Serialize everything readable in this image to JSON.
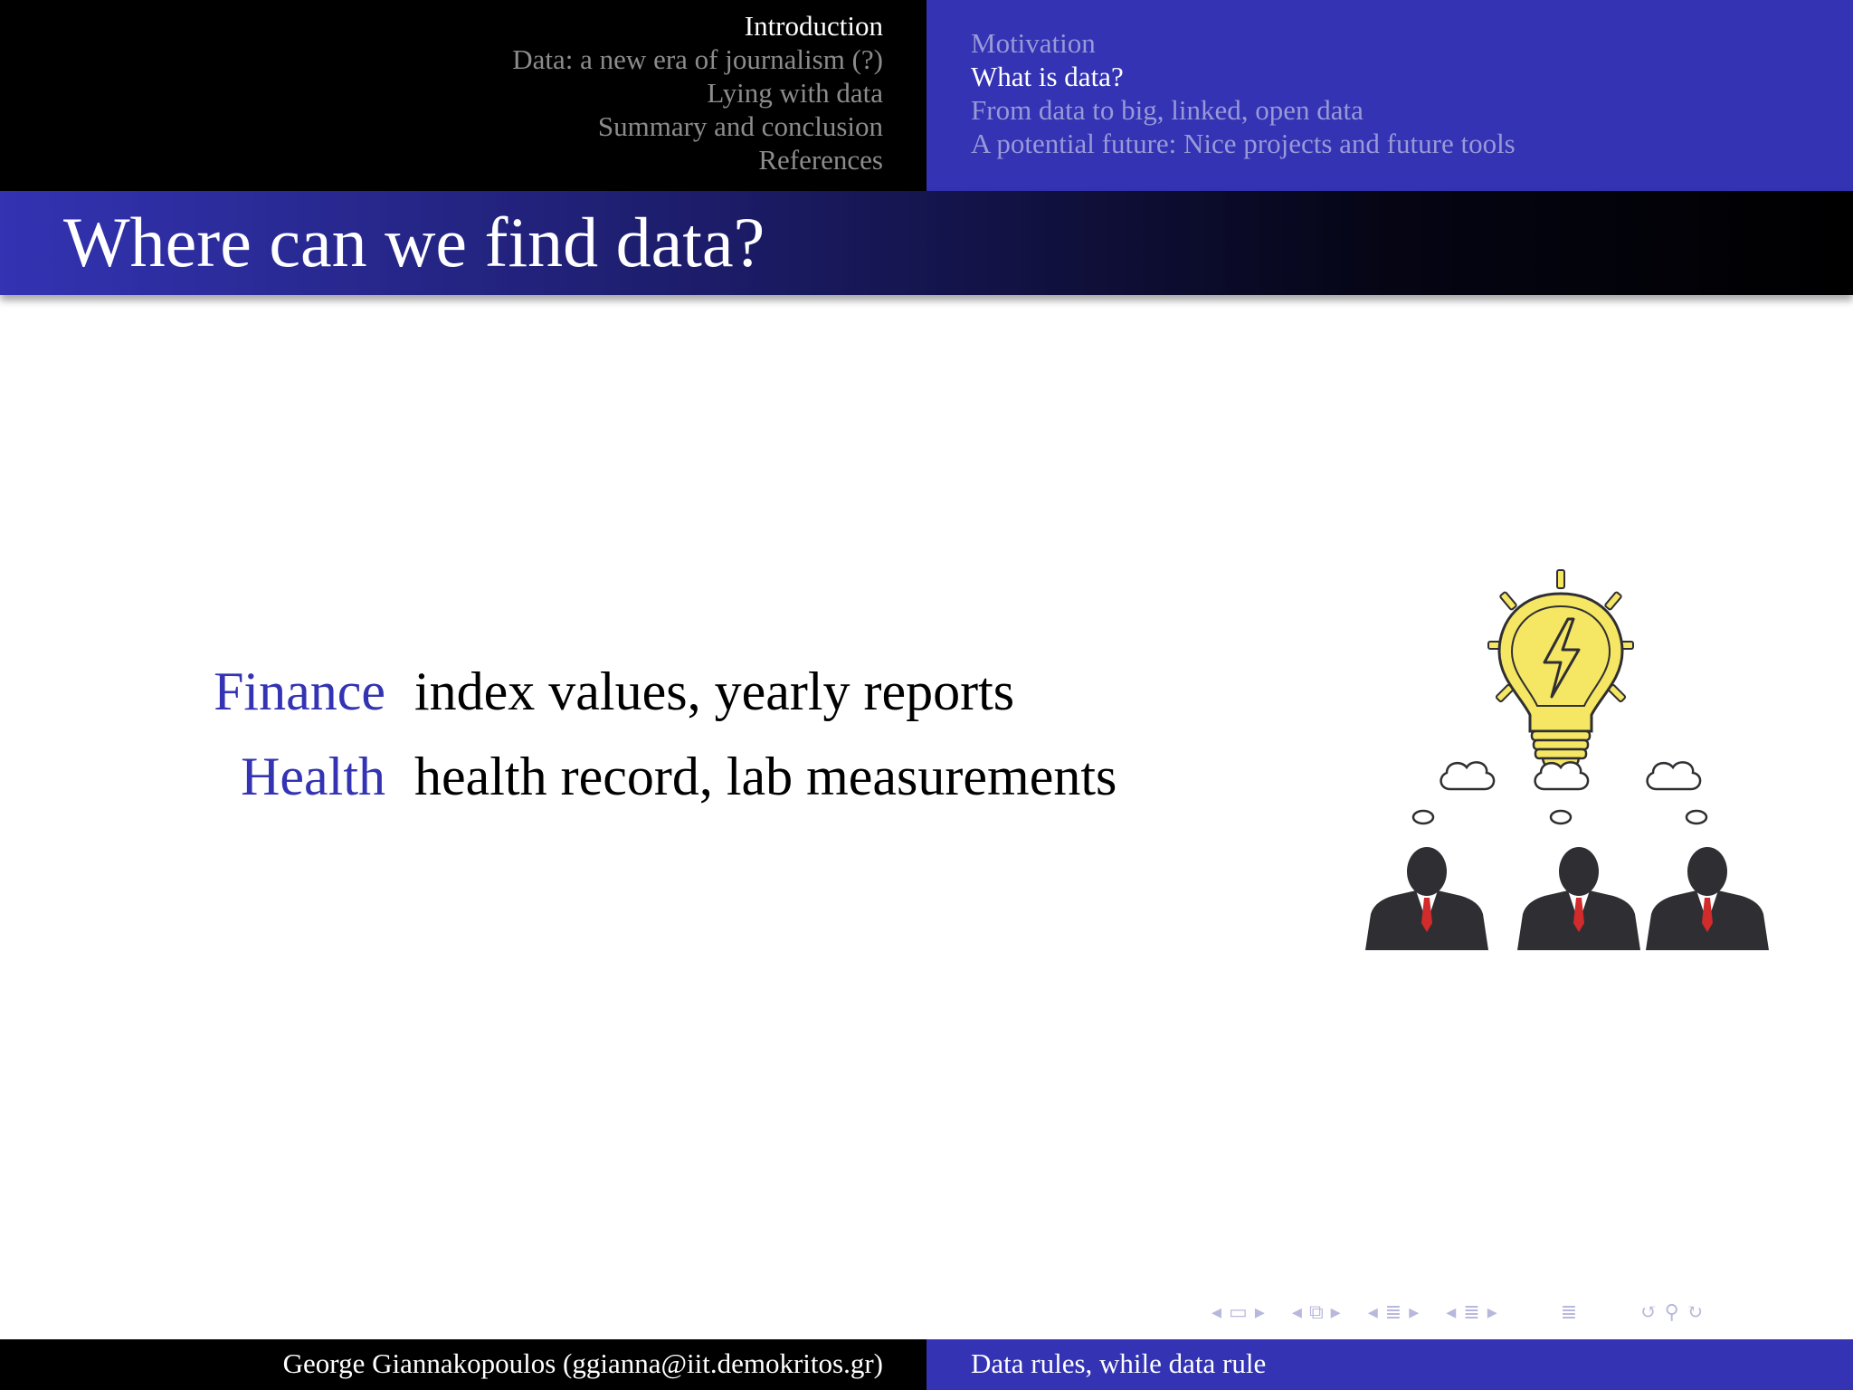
{
  "header": {
    "sections": [
      {
        "label": "Introduction",
        "active": true
      },
      {
        "label": "Data: a new era of  journalism (?)",
        "active": false
      },
      {
        "label": "Lying with data",
        "active": false
      },
      {
        "label": "Summary and conclusion",
        "active": false
      },
      {
        "label": "References",
        "active": false
      }
    ],
    "subsections": [
      {
        "label": "Motivation",
        "active": false
      },
      {
        "label": "What is data?",
        "active": true
      },
      {
        "label": "From data to big, linked, open data",
        "active": false
      },
      {
        "label": "A potential future: Nice projects and future tools",
        "active": false
      }
    ]
  },
  "frame": {
    "title": "Where can we find data?",
    "items": [
      {
        "term": "Finance",
        "definition": "index values, yearly reports"
      },
      {
        "term": "Health",
        "definition": "health record, lab measurements"
      }
    ]
  },
  "illustration": {
    "icons": [
      "lightbulb-icon",
      "thought-cloud-icon",
      "businessman-icon"
    ],
    "colors": {
      "bulb": "#f5e663",
      "person": "#2f2f33",
      "tie": "#d12b2b"
    }
  },
  "navigation": {
    "icons": [
      "arrow-left-icon",
      "frame-icon",
      "arrow-right-icon",
      "subsection-icon",
      "section-icon",
      "align-icon",
      "undo-icon",
      "search-icon",
      "redo-icon"
    ]
  },
  "footer": {
    "author": "George Giannakopoulos  (ggianna@iit.demokritos.gr)",
    "talk_title": "Data rules, while data rule"
  },
  "colors": {
    "accent": "#3333b3",
    "black": "#000000",
    "inactive_section": "#8c8c8c",
    "inactive_subsection": "#9999d9"
  }
}
